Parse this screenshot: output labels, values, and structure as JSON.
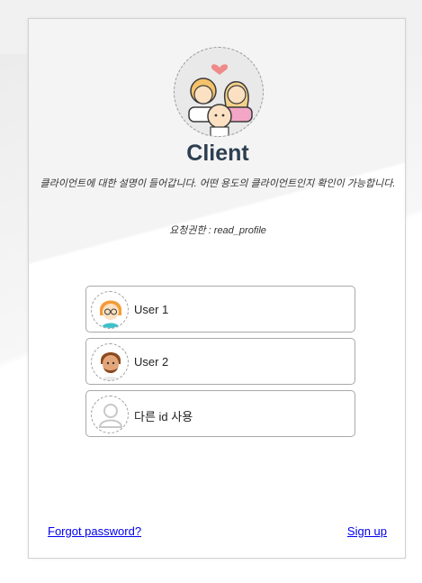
{
  "client": {
    "name": "Client",
    "description": "클라이언트에 대한 설명이 들어갑니다. 어떤 용도의 클라이언트인지 확인이 가능합니다.",
    "scope_label": "요청권한 : ",
    "scope_value": "read_profile"
  },
  "accounts": [
    {
      "label": "User 1",
      "icon": "user-girl-icon"
    },
    {
      "label": "User 2",
      "icon": "user-man-icon"
    },
    {
      "label": "다른 id 사용",
      "icon": "user-placeholder-icon"
    }
  ],
  "links": {
    "forgot_password": "Forgot password?",
    "sign_up": "Sign up"
  },
  "colors": {
    "title": "#2d3e50",
    "link": "#0000ee",
    "border": "#a9a9a9"
  }
}
